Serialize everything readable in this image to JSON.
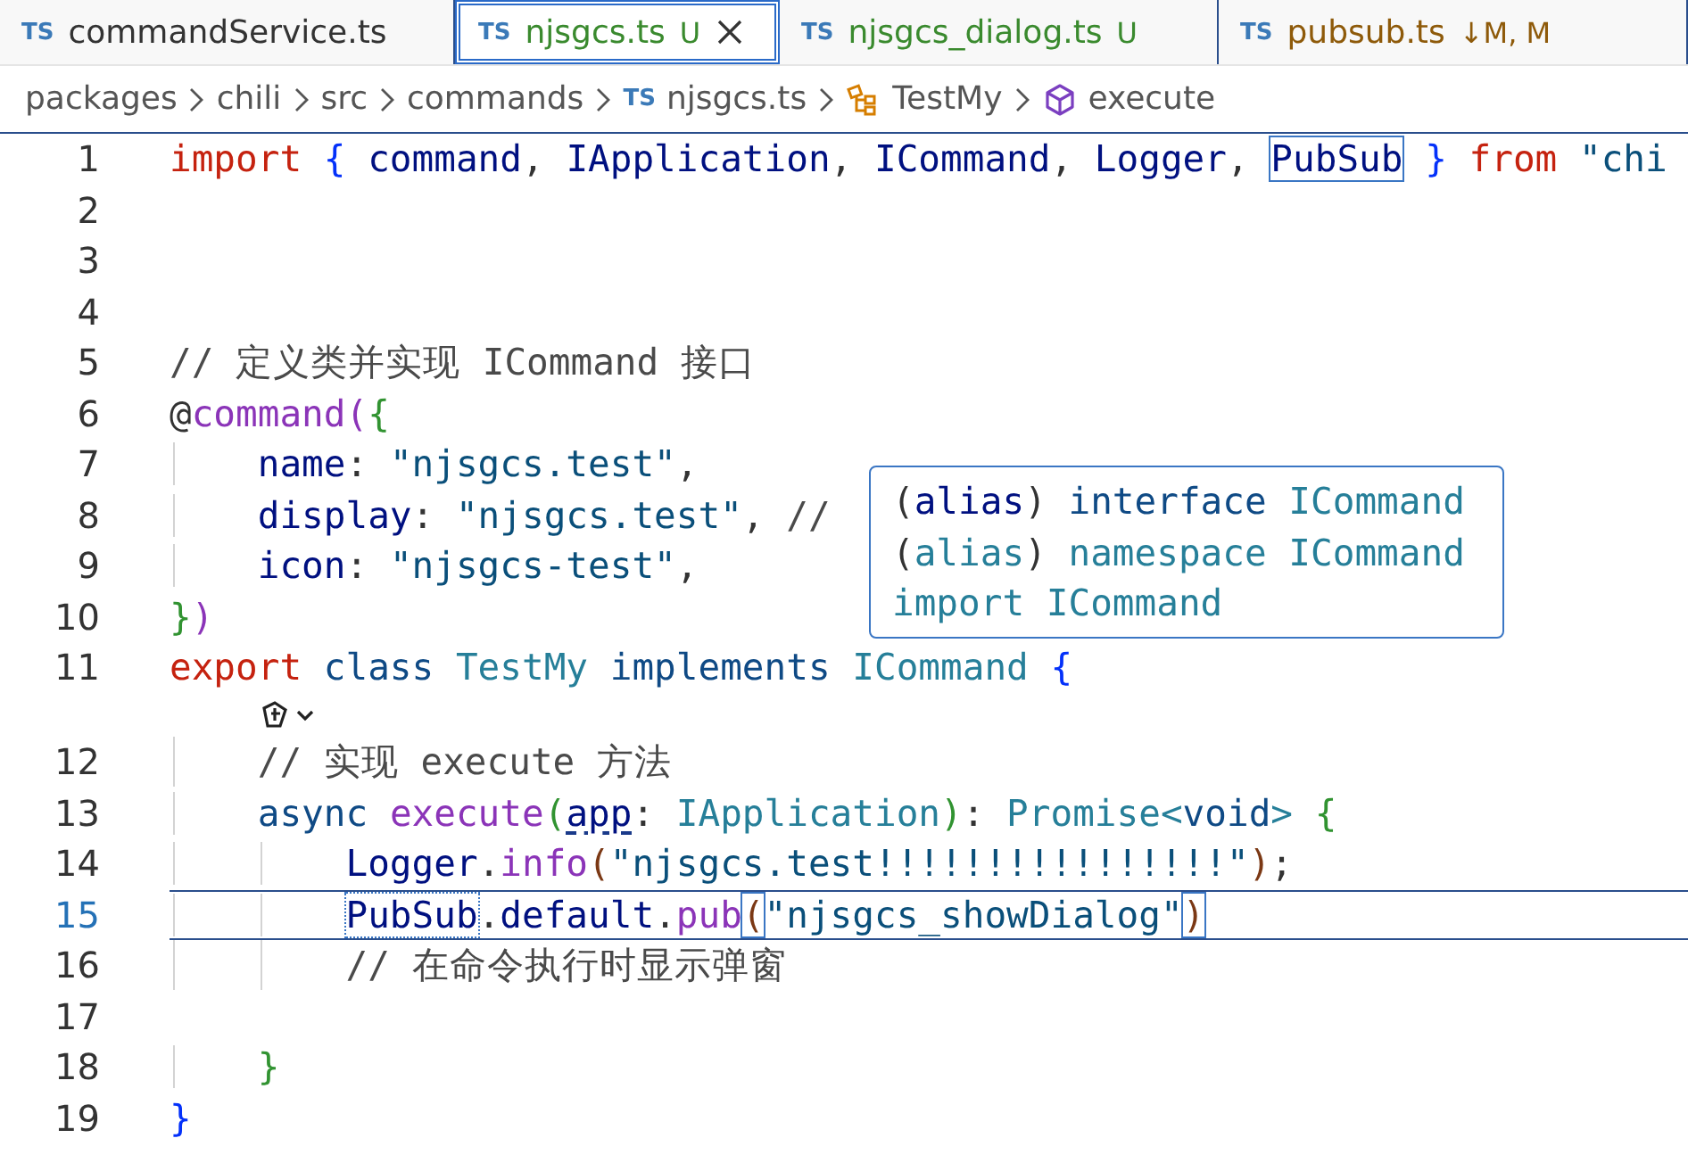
{
  "tabs": [
    {
      "icon_text": "TS",
      "label": "commandService.ts",
      "untracked": false,
      "modified": false,
      "selected": false
    },
    {
      "icon_text": "TS",
      "label": "njsgcs.ts",
      "badge": "U",
      "untracked": true,
      "modified": false,
      "selected": true
    },
    {
      "icon_text": "TS",
      "label": "njsgcs_dialog.ts",
      "badge": "U",
      "untracked": true,
      "modified": false,
      "selected": false
    },
    {
      "icon_text": "TS",
      "label": "pubsub.ts",
      "badge": "↓M, M",
      "untracked": false,
      "modified": true,
      "selected": false
    }
  ],
  "breadcrumbs": [
    {
      "kind": "folder",
      "label": "packages"
    },
    {
      "kind": "folder",
      "label": "chili"
    },
    {
      "kind": "folder",
      "label": "src"
    },
    {
      "kind": "folder",
      "label": "commands"
    },
    {
      "kind": "file",
      "icon_text": "TS",
      "label": "njsgcs.ts"
    },
    {
      "kind": "class",
      "label": "TestMy"
    },
    {
      "kind": "method",
      "label": "execute"
    }
  ],
  "editor": {
    "lines": [
      {
        "kind": "code",
        "number": "1",
        "current": false,
        "tokens": [
          {
            "text": "import ",
            "kind": "keyword"
          },
          {
            "text": "{ ",
            "kind": "bracket1"
          },
          {
            "text": "command",
            "kind": "variable"
          },
          {
            "text": ", "
          },
          {
            "text": "IApplication",
            "kind": "variable"
          },
          {
            "text": ", "
          },
          {
            "text": "ICommand",
            "kind": "variable"
          },
          {
            "text": ", "
          },
          {
            "text": "Logger",
            "kind": "variable"
          },
          {
            "text": ", "
          },
          {
            "text": "PubSub",
            "kind": "variable",
            "highlighted": true
          },
          {
            "text": " } ",
            "kind": "bracket1"
          },
          {
            "text": "from ",
            "kind": "keyword"
          },
          {
            "text": "\"chi",
            "kind": "string"
          }
        ]
      },
      {
        "kind": "code",
        "number": "2",
        "current": false
      },
      {
        "kind": "code",
        "number": "3",
        "current": false
      },
      {
        "kind": "code",
        "number": "4",
        "current": false
      },
      {
        "kind": "code",
        "number": "5",
        "current": false,
        "tokens": [
          {
            "text": "// 定义类并实现 ICommand 接口",
            "kind": "comment"
          }
        ]
      },
      {
        "kind": "code",
        "number": "6",
        "current": false,
        "tokens": [
          {
            "text": "@"
          },
          {
            "text": "command",
            "kind": "function"
          },
          {
            "text": "(",
            "kind": "function"
          },
          {
            "text": "{",
            "kind": "bracket2"
          }
        ]
      },
      {
        "kind": "code",
        "number": "7",
        "current": false,
        "tokens": [
          {
            "text": "    name",
            "kind": "variable"
          },
          {
            "text": ": "
          },
          {
            "text": "\"njsgcs.test\"",
            "kind": "string"
          },
          {
            "text": ","
          }
        ]
      },
      {
        "kind": "code",
        "number": "8",
        "current": false,
        "tokens": [
          {
            "text": "    display",
            "kind": "variable"
          },
          {
            "text": ": "
          },
          {
            "text": "\"njsgcs.test\"",
            "kind": "string"
          },
          {
            "text": ", "
          },
          {
            "text": "//",
            "kind": "comment"
          }
        ]
      },
      {
        "kind": "code",
        "number": "9",
        "current": false,
        "tokens": [
          {
            "text": "    icon",
            "kind": "variable"
          },
          {
            "text": ": "
          },
          {
            "text": "\"njsgcs-test\"",
            "kind": "string"
          },
          {
            "text": ","
          }
        ]
      },
      {
        "kind": "code",
        "number": "10",
        "current": false,
        "tokens": [
          {
            "text": "}",
            "kind": "bracket2"
          },
          {
            "text": ")",
            "kind": "function"
          }
        ]
      },
      {
        "kind": "code",
        "number": "11",
        "current": false,
        "tokens": [
          {
            "text": "export ",
            "kind": "keyword"
          },
          {
            "text": "class ",
            "kind": "storage"
          },
          {
            "text": "TestMy ",
            "kind": "type"
          },
          {
            "text": "implements ",
            "kind": "storage"
          },
          {
            "text": "ICommand ",
            "kind": "type"
          },
          {
            "text": "{",
            "kind": "bracket1"
          }
        ]
      },
      {
        "kind": "action"
      },
      {
        "kind": "code",
        "number": "12",
        "current": false,
        "tokens": [
          {
            "text": "    // 实现 execute 方法",
            "kind": "comment"
          }
        ]
      },
      {
        "kind": "code",
        "number": "13",
        "current": false,
        "tokens": [
          {
            "text": "    async ",
            "kind": "storage"
          },
          {
            "text": "execute",
            "kind": "function"
          },
          {
            "text": "(",
            "kind": "bracket2"
          },
          {
            "text": "app",
            "kind": "variable",
            "hint": true
          },
          {
            "text": ": "
          },
          {
            "text": "IApplication",
            "kind": "type"
          },
          {
            "text": ")",
            "kind": "bracket2"
          },
          {
            "text": ": "
          },
          {
            "text": "Promise",
            "kind": "type"
          },
          {
            "text": "<",
            "kind": "type"
          },
          {
            "text": "void",
            "kind": "storage"
          },
          {
            "text": "> ",
            "kind": "type"
          },
          {
            "text": "{",
            "kind": "bracket2"
          }
        ]
      },
      {
        "kind": "code",
        "number": "14",
        "current": false,
        "tokens": [
          {
            "text": "        Logger",
            "kind": "variable"
          },
          {
            "text": "."
          },
          {
            "text": "info",
            "kind": "function"
          },
          {
            "text": "(",
            "kind": "bracket3"
          },
          {
            "text": "\"njsgcs.test!!!!!!!!!!!!!!!!\"",
            "kind": "string"
          },
          {
            "text": ")",
            "kind": "bracket3"
          },
          {
            "text": ";"
          }
        ]
      },
      {
        "kind": "code",
        "number": "15",
        "current": true,
        "tokens": [
          {
            "text": "        PubSub",
            "kind": "variable",
            "occurrence": true
          },
          {
            "text": "."
          },
          {
            "text": "default",
            "kind": "variable"
          },
          {
            "text": "."
          },
          {
            "text": "pub",
            "kind": "function"
          },
          {
            "text": "(",
            "kind": "bracket3",
            "highlighted": true
          },
          {
            "text": "\"njsgcs_showDialog\"",
            "kind": "string"
          },
          {
            "text": ")",
            "kind": "bracket3",
            "highlighted": true
          }
        ]
      },
      {
        "kind": "code",
        "number": "16",
        "current": false,
        "tokens": [
          {
            "text": "        // 在命令执行时显示弹窗",
            "kind": "comment"
          }
        ]
      },
      {
        "kind": "code",
        "number": "17",
        "current": false
      },
      {
        "kind": "code",
        "number": "18",
        "current": false,
        "tokens": [
          {
            "text": "    }",
            "kind": "bracket2"
          }
        ]
      },
      {
        "kind": "code",
        "number": "19",
        "current": false,
        "tokens": [
          {
            "text": "}",
            "kind": "bracket1"
          }
        ]
      }
    ],
    "hover": {
      "lines": [
        [
          {
            "text": "(",
            "kind": "punct"
          },
          {
            "text": "alias",
            "kind": "variable"
          },
          {
            "text": ") ",
            "kind": "punct"
          },
          {
            "text": "interface ",
            "kind": "storage"
          },
          {
            "text": "ICommand",
            "kind": "type"
          }
        ],
        [
          {
            "text": "(",
            "kind": "punct"
          },
          {
            "text": "alias",
            "kind": "type"
          },
          {
            "text": ") ",
            "kind": "punct"
          },
          {
            "text": "namespace ",
            "kind": "type"
          },
          {
            "text": "ICommand",
            "kind": "type"
          }
        ],
        [
          {
            "text": "import ",
            "kind": "type"
          },
          {
            "text": "ICommand",
            "kind": "type"
          }
        ]
      ]
    }
  }
}
